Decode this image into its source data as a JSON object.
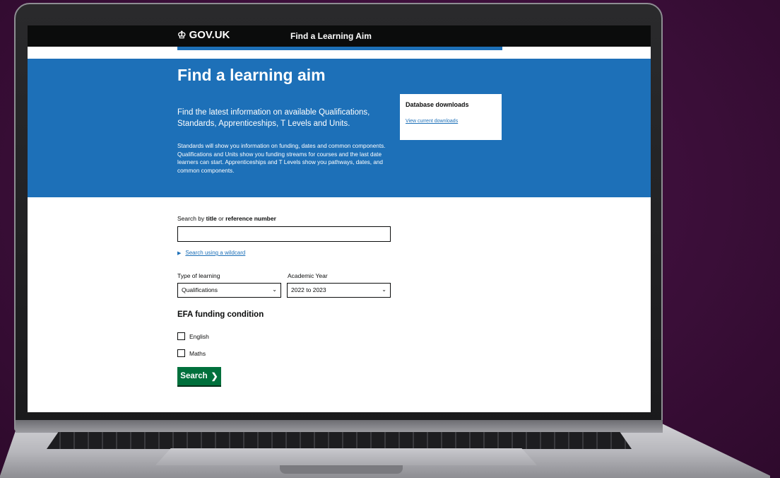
{
  "header": {
    "logo_text": "GOV.UK",
    "logo_icon": "crown-icon",
    "service_name": "Find a Learning Aim"
  },
  "hero": {
    "title": "Find a learning aim",
    "lead": "Find the latest information on available Qualifications, Standards, Apprenticeships, T Levels and Units.",
    "body": "Standards will show you information on funding, dates and common components. Qualifications and Units show you funding streams for courses and the last date learners can start. Apprenticeships and T Levels show you pathways, dates, and common components."
  },
  "downloads": {
    "title": "Database downloads",
    "link": "View current downloads"
  },
  "search": {
    "label_prefix": "Search by",
    "label_title": "title",
    "label_or": "or",
    "label_ref": "reference number",
    "value": "",
    "wildcard_link": "Search using a wildcard"
  },
  "filters": {
    "type_label": "Type of learning",
    "type_value": "Qualifications",
    "year_label": "Academic Year",
    "year_value": "2022 to 2023"
  },
  "efa": {
    "heading": "EFA funding condition",
    "options": [
      "English",
      "Maths"
    ]
  },
  "button": {
    "label": "Search",
    "arrow": "❯"
  },
  "colors": {
    "header": "#0b0c0c",
    "brand_blue": "#1d70b8",
    "button_green": "#00703c",
    "backdrop": "#3d0f3b"
  }
}
